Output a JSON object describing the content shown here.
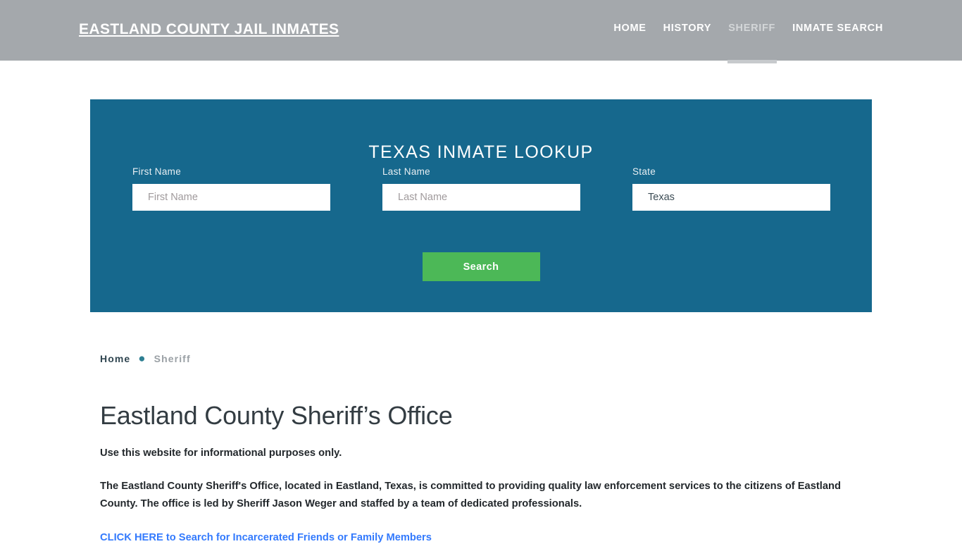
{
  "header": {
    "brand": "Eastland County Jail Inmates",
    "nav": [
      {
        "label": "Home",
        "active": false
      },
      {
        "label": "History",
        "active": false
      },
      {
        "label": "Sheriff",
        "active": true
      },
      {
        "label": "Inmate Search",
        "active": false
      }
    ]
  },
  "lookup": {
    "title": "Texas Inmate Lookup",
    "first_name": {
      "label": "First Name",
      "placeholder": "First Name",
      "value": ""
    },
    "last_name": {
      "label": "Last Name",
      "placeholder": "Last Name",
      "value": ""
    },
    "state": {
      "label": "State",
      "selected": "Texas"
    },
    "search_button": "Search"
  },
  "breadcrumb": {
    "home": "Home",
    "separator": "●",
    "current": "Sheriff"
  },
  "main": {
    "title": "Eastland County Sheriff’s Office",
    "lede": "Use this website for informational purposes only.",
    "paragraph": "The Eastland County Sheriff's Office, located in Eastland, Texas, is committed to providing quality law enforcement services to the citizens of Eastland County. The office is led by Sheriff Jason Weger and staffed by a team of dedicated professionals.",
    "cta_link": "CLICK HERE to Search for Incarcerated Friends or Family Members"
  },
  "colors": {
    "header_bg": "#a4a8ac",
    "panel_bg": "#16688d",
    "search_button": "#4cb857",
    "link_blue": "#337afd",
    "breadcrumb_accent": "#2e7f92"
  }
}
